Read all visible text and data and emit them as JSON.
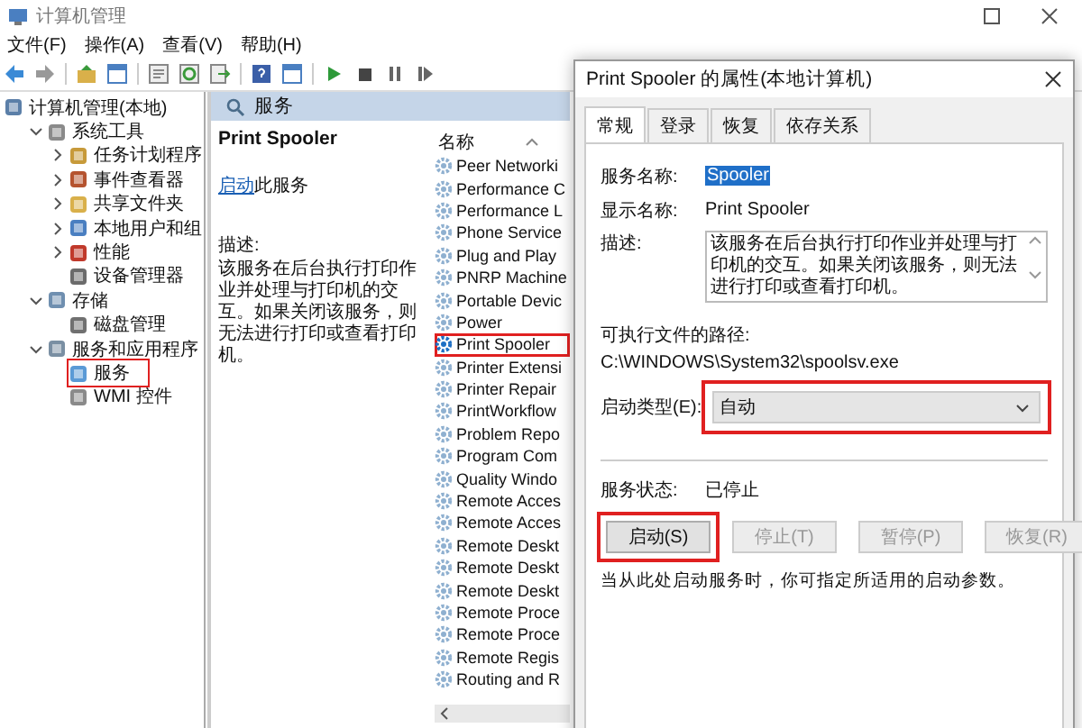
{
  "window": {
    "title": "计算机管理"
  },
  "menu": [
    "文件(F)",
    "操作(A)",
    "查看(V)",
    "帮助(H)"
  ],
  "toolbar": [
    {
      "kind": "back"
    },
    {
      "kind": "forward"
    },
    {
      "kind": "sep"
    },
    {
      "kind": "up"
    },
    {
      "kind": "pane"
    },
    {
      "kind": "sep"
    },
    {
      "kind": "props"
    },
    {
      "kind": "refresh"
    },
    {
      "kind": "export"
    },
    {
      "kind": "sep"
    },
    {
      "kind": "help"
    },
    {
      "kind": "pane"
    },
    {
      "kind": "sep"
    },
    {
      "kind": "play"
    },
    {
      "kind": "stop"
    },
    {
      "kind": "pause"
    },
    {
      "kind": "restart"
    }
  ],
  "tree": {
    "label": "计算机管理(本地)",
    "children": [
      {
        "label": "系统工具",
        "expanded": true,
        "children": [
          {
            "label": "任务计划程序",
            "expanded": false
          },
          {
            "label": "事件查看器",
            "expanded": false
          },
          {
            "label": "共享文件夹",
            "expanded": false
          },
          {
            "label": "本地用户和组",
            "expanded": false
          },
          {
            "label": "性能",
            "expanded": false
          },
          {
            "label": "设备管理器"
          }
        ]
      },
      {
        "label": "存储",
        "expanded": true,
        "children": [
          {
            "label": "磁盘管理"
          }
        ]
      },
      {
        "label": "服务和应用程序",
        "expanded": true,
        "children": [
          {
            "label": "服务",
            "highlighted": true
          },
          {
            "label": "WMI 控件"
          }
        ]
      }
    ]
  },
  "services_pane": {
    "header": "服务",
    "title": "Print Spooler",
    "action_link": "启动",
    "action_rest": "此服务",
    "desc_label": "描述:",
    "description": "该服务在后台执行打印作业并处理与打印机的交互。如果关闭该服务，则无法进行打印或查看打印机。",
    "column": "名称",
    "rows": [
      {
        "name": "Peer Networki",
        "highlighted": false
      },
      {
        "name": "Performance C",
        "highlighted": false
      },
      {
        "name": "Performance L",
        "highlighted": false
      },
      {
        "name": "Phone Service",
        "highlighted": false
      },
      {
        "name": "Plug and Play",
        "highlighted": false
      },
      {
        "name": "PNRP Machine",
        "highlighted": false
      },
      {
        "name": "Portable Devic",
        "highlighted": false
      },
      {
        "name": "Power",
        "highlighted": false
      },
      {
        "name": "Print Spooler",
        "highlighted": true
      },
      {
        "name": "Printer Extensi",
        "highlighted": false
      },
      {
        "name": "Printer Repair",
        "highlighted": false
      },
      {
        "name": "PrintWorkflow",
        "highlighted": false
      },
      {
        "name": "Problem Repo",
        "highlighted": false
      },
      {
        "name": "Program Com",
        "highlighted": false
      },
      {
        "name": "Quality Windo",
        "highlighted": false
      },
      {
        "name": "Remote Acces",
        "highlighted": false
      },
      {
        "name": "Remote Acces",
        "highlighted": false
      },
      {
        "name": "Remote Deskt",
        "highlighted": false
      },
      {
        "name": "Remote Deskt",
        "highlighted": false
      },
      {
        "name": "Remote Deskt",
        "highlighted": false
      },
      {
        "name": "Remote Proce",
        "highlighted": false
      },
      {
        "name": "Remote Proce",
        "highlighted": false
      },
      {
        "name": "Remote Regis",
        "highlighted": false
      },
      {
        "name": "Routing and R",
        "highlighted": false
      }
    ]
  },
  "dialog": {
    "title": "Print Spooler 的属性(本地计算机)",
    "tabs": [
      {
        "label": "常规",
        "selected": true
      },
      {
        "label": "登录",
        "selected": false
      },
      {
        "label": "恢复",
        "selected": false
      },
      {
        "label": "依存关系",
        "selected": false
      }
    ],
    "service_name": {
      "label": "服务名称:",
      "value": "Spooler"
    },
    "display_name": {
      "label": "显示名称:",
      "value": "Print Spooler"
    },
    "description": {
      "label": "描述:",
      "value": "该服务在后台执行打印作业并处理与打印机的交互。如果关闭该服务，则无法进行打印或查看打印机。"
    },
    "path_label": "可执行文件的路径:",
    "path": "C:\\WINDOWS\\System32\\spoolsv.exe",
    "startup_type": {
      "label": "启动类型(E):",
      "value": "自动",
      "highlighted": true
    },
    "status": {
      "label": "服务状态:",
      "value": "已停止"
    },
    "buttons": [
      {
        "label": "启动(S)",
        "disabled": false,
        "highlighted": true
      },
      {
        "label": "停止(T)",
        "disabled": true,
        "highlighted": false
      },
      {
        "label": "暂停(P)",
        "disabled": true,
        "highlighted": false
      },
      {
        "label": "恢复(R)",
        "disabled": true,
        "highlighted": false
      }
    ],
    "note": "当从此处启动服务时，你可指定所适用的启动参数。"
  }
}
